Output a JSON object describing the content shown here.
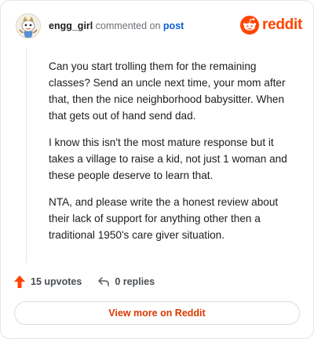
{
  "header": {
    "username": "engg_girl",
    "verb": "commented on",
    "post_link": "post",
    "brand": "reddit"
  },
  "comment": {
    "paragraphs": [
      "Can you start trolling them for the remaining classes? Send an uncle next time, your mom after that, then the nice neighborhood babysitter. When that gets out of hand send dad.",
      "I know this isn't the most mature response but it takes a village to raise a kid, not just 1 woman and these people deserve to learn that.",
      "NTA, and please write the a honest review about their lack of support for anything other then a traditional 1950's care giver situation."
    ]
  },
  "actions": {
    "upvotes_label": "15 upvotes",
    "replies_label": "0 replies"
  },
  "footer": {
    "view_more_label": "View more on Reddit"
  },
  "colors": {
    "brand_orange": "#ff4500",
    "link_blue": "#0b5ed7",
    "cta_text": "#d93a00"
  },
  "icons": {
    "avatar": "cartoon-avatar",
    "upvote": "upvote-arrow-icon",
    "reply": "reply-arrow-icon",
    "brand": "reddit-snoo-icon"
  }
}
